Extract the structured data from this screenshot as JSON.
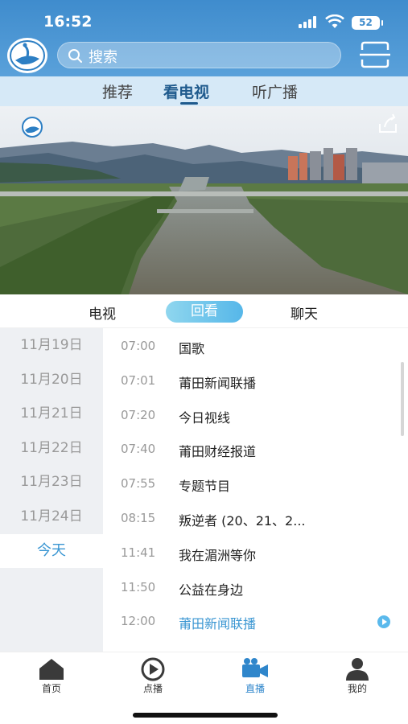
{
  "status_bar": {
    "time": "16:52",
    "battery": "52"
  },
  "header": {
    "search_placeholder": "搜索"
  },
  "top_tabs": [
    {
      "label": "推荐",
      "active": false
    },
    {
      "label": "看电视",
      "active": true
    },
    {
      "label": "听广播",
      "active": false
    }
  ],
  "sub_tabs": [
    {
      "label": "电视",
      "active": false
    },
    {
      "label": "回看",
      "active": true
    },
    {
      "label": "聊天",
      "active": false
    }
  ],
  "dates": [
    "11月19日",
    "11月20日",
    "11月21日",
    "11月22日",
    "11月23日",
    "11月24日",
    "今天"
  ],
  "selected_date": "今天",
  "programs": [
    {
      "time": "07:00",
      "name": "国歌"
    },
    {
      "time": "07:01",
      "name": "莆田新闻联播"
    },
    {
      "time": "07:20",
      "name": "今日视线"
    },
    {
      "time": "07:40",
      "name": "莆田财经报道"
    },
    {
      "time": "07:55",
      "name": "专题节目"
    },
    {
      "time": "08:15",
      "name": "叛逆者 (20、21、2..."
    },
    {
      "time": "11:41",
      "name": "我在湄洲等你"
    },
    {
      "time": "11:50",
      "name": "公益在身边"
    },
    {
      "time": "12:00",
      "name": "莆田新闻联播",
      "live": true
    }
  ],
  "bottom_nav": [
    {
      "label": "首页",
      "icon": "home-icon",
      "active": false
    },
    {
      "label": "点播",
      "icon": "play-circle-icon",
      "active": false
    },
    {
      "label": "直播",
      "icon": "video-camera-icon",
      "active": true
    },
    {
      "label": "我的",
      "icon": "person-icon",
      "active": false
    }
  ],
  "colors": {
    "header": "#3f8ccd",
    "accent": "#3a96d2",
    "tab_bg": "#d6e9f7",
    "date_bg": "#eef0f3"
  }
}
